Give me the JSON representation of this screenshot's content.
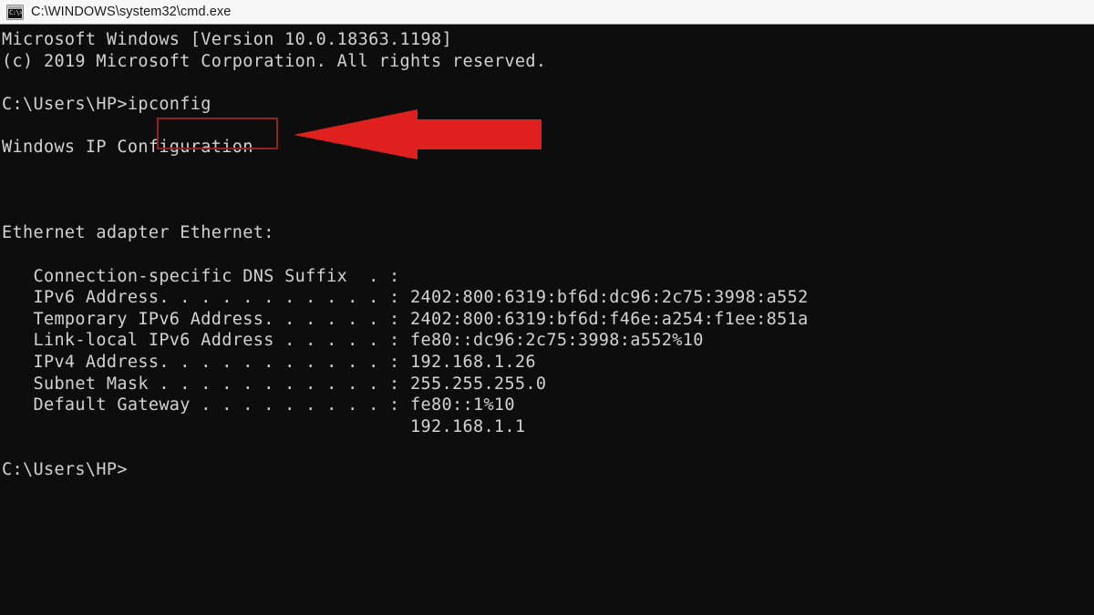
{
  "window": {
    "title": "C:\\WINDOWS\\system32\\cmd.exe",
    "icon": "cmd-console-icon",
    "icon_glyph": "C:\\>",
    "titlebar_bg": "#f7f7f7",
    "titlebar_text_color": "#1a1a1a"
  },
  "console": {
    "background": "#0d0d0d",
    "foreground": "#d2d2d2",
    "lines": [
      "Microsoft Windows [Version 10.0.18363.1198]",
      "(c) 2019 Microsoft Corporation. All rights reserved.",
      "",
      "C:\\Users\\HP>ipconfig",
      "",
      "Windows IP Configuration",
      "",
      "",
      "",
      "Ethernet adapter Ethernet:",
      "",
      "   Connection-specific DNS Suffix  . :",
      "   IPv6 Address. . . . . . . . . . . : 2402:800:6319:bf6d:dc96:2c75:3998:a552",
      "   Temporary IPv6 Address. . . . . . : 2402:800:6319:bf6d:f46e:a254:f1ee:851a",
      "   Link-local IPv6 Address . . . . . : fe80::dc96:2c75:3998:a552%10",
      "   IPv4 Address. . . . . . . . . . . : 192.168.1.26",
      "   Subnet Mask . . . . . . . . . . . : 255.255.255.0",
      "   Default Gateway . . . . . . . . . : fe80::1%10",
      "                                       192.168.1.1",
      "",
      "C:\\Users\\HP>"
    ],
    "os_version": "10.0.18363.1198",
    "copyright_year": "2019",
    "prompt": "C:\\Users\\HP>",
    "command": "ipconfig",
    "adapter": "Ethernet adapter Ethernet:",
    "section_header": "Windows IP Configuration",
    "fields": [
      {
        "label": "Connection-specific DNS Suffix",
        "value": ""
      },
      {
        "label": "IPv6 Address",
        "value": "2402:800:6319:bf6d:dc96:2c75:3998:a552"
      },
      {
        "label": "Temporary IPv6 Address",
        "value": "2402:800:6319:bf6d:f46e:a254:f1ee:851a"
      },
      {
        "label": "Link-local IPv6 Address",
        "value": "fe80::dc96:2c75:3998:a552%10"
      },
      {
        "label": "IPv4 Address",
        "value": "192.168.1.26"
      },
      {
        "label": "Subnet Mask",
        "value": "255.255.255.0"
      },
      {
        "label": "Default Gateway",
        "value": "fe80::1%10"
      },
      {
        "label": "Default Gateway (continued)",
        "value": "192.168.1.1"
      }
    ]
  },
  "annotations": {
    "highlight_box": {
      "target_text": "ipconfig",
      "border_color": "#8f2222"
    },
    "arrow": {
      "direction": "left",
      "color": "#e01f1f",
      "points_at": "ipconfig"
    }
  }
}
